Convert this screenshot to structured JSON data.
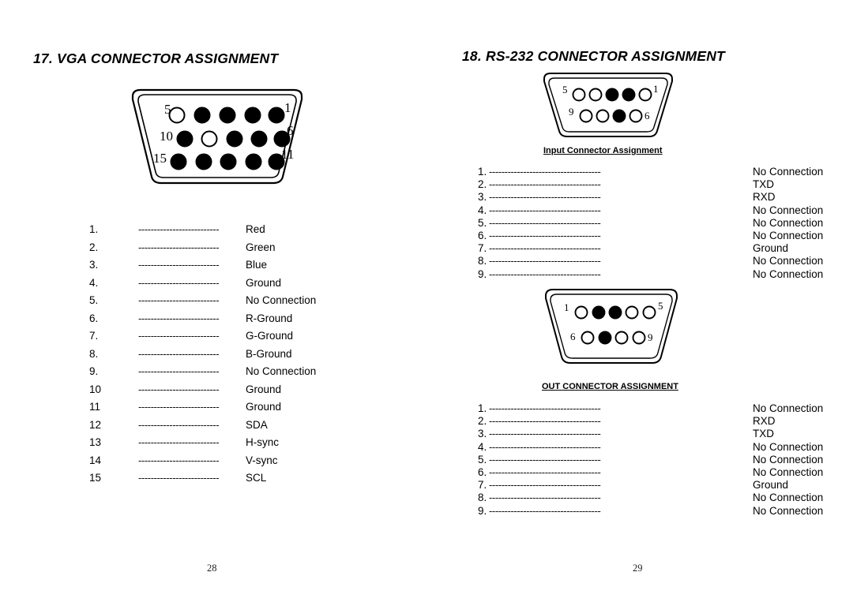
{
  "page": {
    "left_page_number": "28",
    "right_page_number": "29"
  },
  "vga_section": {
    "heading": "17. VGA CONNECTOR ASSIGNMENT",
    "connector": {
      "name": "vga-db15-connector",
      "row_labels": {
        "top_left": "5",
        "top_right": "1",
        "mid_left": "10",
        "mid_right": "6",
        "bot_left": "15",
        "bot_right": "11"
      },
      "rows": [
        {
          "label_left": "5",
          "label_right": "1",
          "pins": [
            "open",
            "filled",
            "filled",
            "filled",
            "filled"
          ]
        },
        {
          "label_left": "10",
          "label_right": "6",
          "pins": [
            "filled",
            "open",
            "filled",
            "filled",
            "filled"
          ]
        },
        {
          "label_left": "15",
          "label_right": "11",
          "pins": [
            "filled",
            "filled",
            "filled",
            "filled",
            "filled"
          ]
        }
      ]
    },
    "dash_leader": "--------------------------",
    "pins": [
      {
        "num": "1.",
        "signal": "Red"
      },
      {
        "num": "2.",
        "signal": "Green"
      },
      {
        "num": "3.",
        "signal": "Blue"
      },
      {
        "num": "4.",
        "signal": "Ground"
      },
      {
        "num": "5.",
        "signal": "No Connection"
      },
      {
        "num": "6.",
        "signal": "R-Ground"
      },
      {
        "num": "7.",
        "signal": "G-Ground"
      },
      {
        "num": "8.",
        "signal": "B-Ground"
      },
      {
        "num": "9.",
        "signal": "No Connection"
      },
      {
        "num": "10",
        "signal": "Ground"
      },
      {
        "num": "11",
        "signal": "Ground"
      },
      {
        "num": "12",
        "signal": "SDA"
      },
      {
        "num": "13",
        "signal": "H-sync"
      },
      {
        "num": "14",
        "signal": "V-sync"
      },
      {
        "num": "15",
        "signal": "SCL"
      }
    ]
  },
  "rs232_section": {
    "heading": "18. RS-232 CONNECTOR ASSIGNMENT",
    "dash_leader": "------------------------------------",
    "input": {
      "caption": "Input Connector Assignment",
      "connector": {
        "name": "rs232-input-db9-connector",
        "rows": [
          {
            "label_left": "5",
            "label_right": "1",
            "pins": [
              "open",
              "open",
              "filled",
              "filled",
              "open"
            ]
          },
          {
            "label_left": "9",
            "label_right": "6",
            "pins": [
              "open",
              "open",
              "filled",
              "open"
            ]
          }
        ]
      },
      "pins": [
        {
          "num": "1.",
          "signal": "No Connection"
        },
        {
          "num": "2.",
          "signal": "TXD"
        },
        {
          "num": "3.",
          "signal": "RXD"
        },
        {
          "num": "4.",
          "signal": "No Connection"
        },
        {
          "num": "5.",
          "signal": "No Connection"
        },
        {
          "num": "6.",
          "signal": "No Connection"
        },
        {
          "num": "7.",
          "signal": "Ground"
        },
        {
          "num": "8.",
          "signal": "No Connection"
        },
        {
          "num": "9.",
          "signal": "No Connection"
        }
      ]
    },
    "output": {
      "caption": "OUT CONNECTOR ASSIGNMENT",
      "connector": {
        "name": "rs232-out-db9-connector",
        "rows": [
          {
            "label_left": "1",
            "label_right": "5",
            "pins": [
              "open",
              "filled",
              "filled",
              "open",
              "open"
            ]
          },
          {
            "label_left": "6",
            "label_right": "9",
            "pins": [
              "open",
              "filled",
              "open",
              "open"
            ]
          }
        ]
      },
      "pins": [
        {
          "num": "1.",
          "signal": "No Connection"
        },
        {
          "num": "2.",
          "signal": "RXD"
        },
        {
          "num": "3.",
          "signal": "TXD"
        },
        {
          "num": "4.",
          "signal": "No Connection"
        },
        {
          "num": "5.",
          "signal": "No Connection"
        },
        {
          "num": "6.",
          "signal": "No Connection"
        },
        {
          "num": "7.",
          "signal": "Ground"
        },
        {
          "num": "8.",
          "signal": "No Connection"
        },
        {
          "num": "9.",
          "signal": "No Connection"
        }
      ]
    }
  },
  "colors": {
    "ink": "#000000",
    "paper": "#ffffff",
    "pin_filled": "#000000",
    "pin_open": "#ffffff"
  }
}
